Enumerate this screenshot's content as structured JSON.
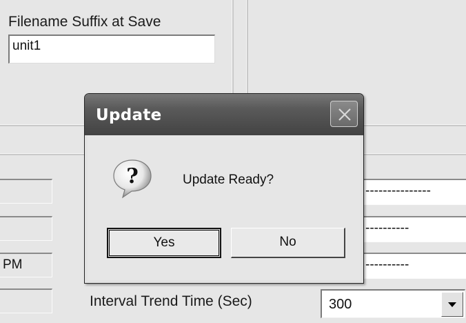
{
  "top_panel": {
    "suffix_label": "Filename Suffix at Save",
    "suffix_value": "unit1"
  },
  "left_fields": {
    "fields": [
      "",
      "",
      "PM",
      ""
    ]
  },
  "right_fields": {
    "values": [
      "---------------",
      "----------",
      "----------"
    ]
  },
  "trend": {
    "label": "Interval Trend Time (Sec)",
    "value": "300"
  },
  "dialog": {
    "title": "Update",
    "message": "Update Ready?",
    "yes_label": "Yes",
    "no_label": "No",
    "icon": "question-icon"
  },
  "colors": {
    "background": "#e6e6e6",
    "title_bar": "#4a4a4a"
  }
}
